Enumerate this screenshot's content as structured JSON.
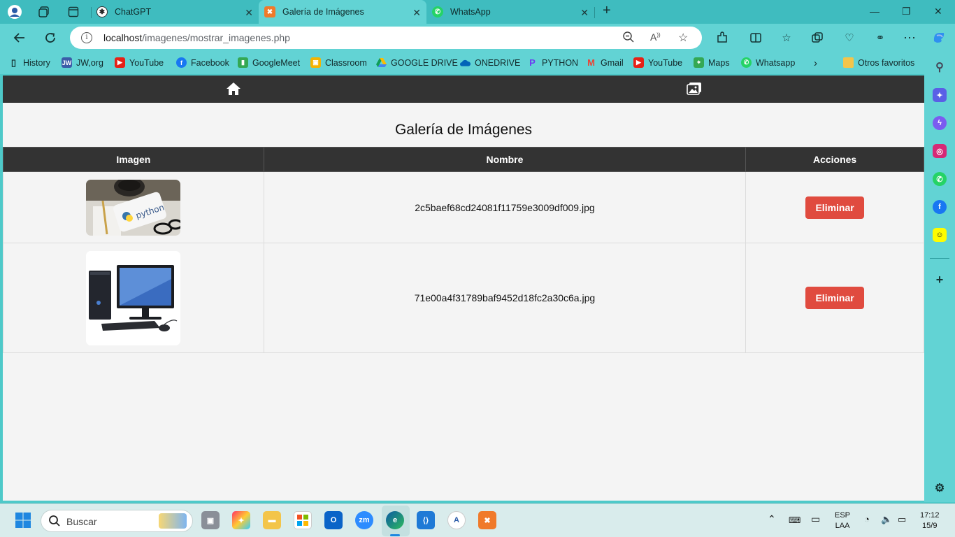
{
  "browser": {
    "tabs": [
      {
        "title": "ChatGPT",
        "active": false
      },
      {
        "title": "Galería de Imágenes",
        "active": true
      },
      {
        "title": "WhatsApp",
        "active": false
      }
    ],
    "url_host": "localhost",
    "url_path": "/imagenes/mostrar_imagenes.php",
    "bookmarks": [
      {
        "label": "History",
        "icon": "page-icon"
      },
      {
        "label": "JW,org",
        "icon": "jw-icon"
      },
      {
        "label": "YouTube",
        "icon": "youtube-icon"
      },
      {
        "label": "Facebook",
        "icon": "facebook-icon"
      },
      {
        "label": "GoogleMeet",
        "icon": "meet-icon"
      },
      {
        "label": "Classroom",
        "icon": "classroom-icon"
      },
      {
        "label": "GOOGLE DRIVE",
        "icon": "drive-icon"
      },
      {
        "label": "ONEDRIVE",
        "icon": "onedrive-icon"
      },
      {
        "label": "PYTHON",
        "icon": "python-icon"
      },
      {
        "label": "Gmail",
        "icon": "gmail-icon"
      },
      {
        "label": "YouTube",
        "icon": "youtube-icon"
      },
      {
        "label": "Maps",
        "icon": "maps-icon"
      },
      {
        "label": "Whatsapp",
        "icon": "whatsapp-icon"
      }
    ],
    "other_favorites": "Otros favoritos"
  },
  "page": {
    "title": "Galería de Imágenes",
    "table": {
      "headers": [
        "Imagen",
        "Nombre",
        "Acciones"
      ],
      "rows": [
        {
          "image": "python-laptop-photo",
          "name": "2c5baef68cd24081f11759e3009df009.jpg",
          "action": "Eliminar"
        },
        {
          "image": "desktop-computer-photo",
          "name": "71e00a4f31789baf9452d18fc2a30c6a.jpg",
          "action": "Eliminar"
        }
      ]
    }
  },
  "taskbar": {
    "search_placeholder": "Buscar",
    "language": "ESP",
    "layout": "LAA",
    "time": "17:12",
    "date": "15/9"
  }
}
